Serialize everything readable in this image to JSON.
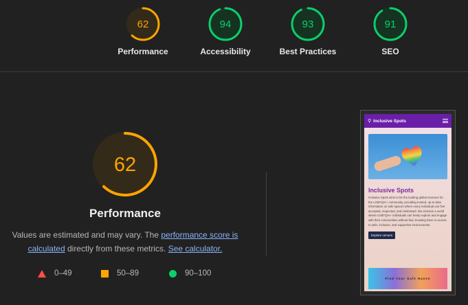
{
  "top_gauges": [
    {
      "score": "62",
      "label": "Performance",
      "status": "average",
      "fraction": 0.62
    },
    {
      "score": "94",
      "label": "Accessibility",
      "status": "pass",
      "fraction": 0.94
    },
    {
      "score": "93",
      "label": "Best Practices",
      "status": "pass",
      "fraction": 0.93
    },
    {
      "score": "91",
      "label": "SEO",
      "status": "pass",
      "fraction": 0.91
    }
  ],
  "main": {
    "score": "62",
    "fraction": 0.62,
    "title": "Performance",
    "desc_prefix": "Values are estimated and may vary. The ",
    "link_score": "performance score is calculated",
    "desc_middle": " directly from these metrics. ",
    "link_calc": "See calculator."
  },
  "legend": [
    {
      "shape": "triangle",
      "range": "0–49"
    },
    {
      "shape": "square",
      "range": "50–89"
    },
    {
      "shape": "circle",
      "range": "90–100"
    }
  ],
  "screenshot": {
    "brand": "Inclusive Spots",
    "heading": "Inclusive Spots",
    "paragraph": "Inclusive Spots aims to be the leading global resource for the LGBTQIA+ community, providing trusted, up-to-date information on safe spaces where every individual can feel accepted, respected, and celebrated. We envision a world where LGBTQIA+ individuals can freely explore and engage with their communities without fear, knowing there is access to safe, inclusive, and supportive environments.",
    "button": "Explore venues",
    "banner": "Find Your Safe Haven"
  },
  "colors": {
    "average": "#ffa400",
    "average_bg": "#332a1a",
    "pass": "#0cce6b",
    "pass_bg": "#163322",
    "fail": "#ff4e42",
    "link": "#8ab4f8"
  }
}
